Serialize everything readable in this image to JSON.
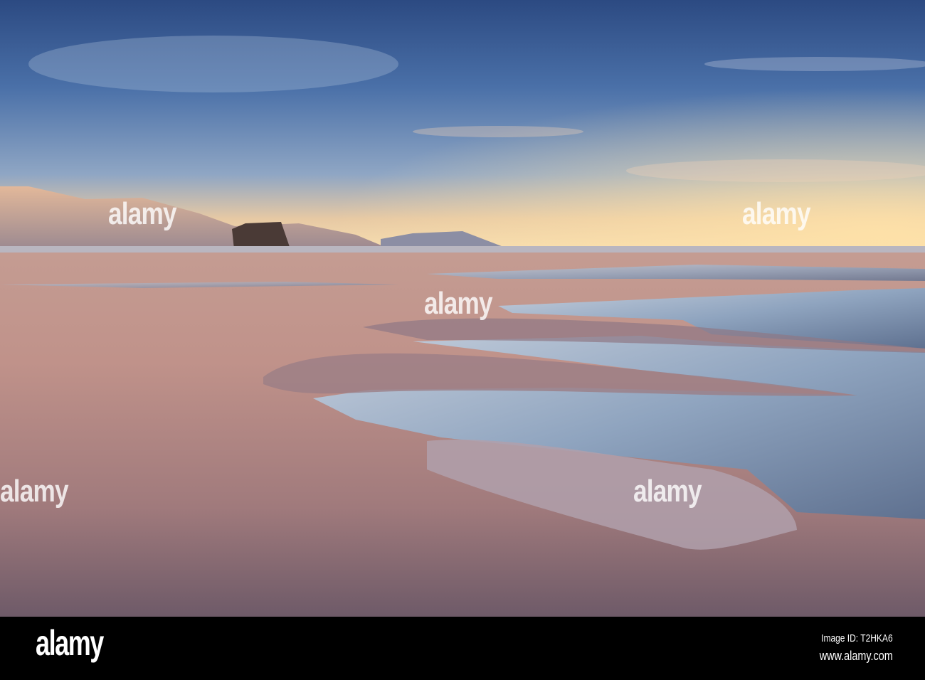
{
  "watermark": {
    "text": "alamy"
  },
  "footer": {
    "logo": "alamy",
    "image_id": "Image ID: T2HKA6",
    "website": "www.alamy.com"
  },
  "colors": {
    "sky_top": "#2f4f86",
    "horizon": "#f4d9a8",
    "sand": "#b98a85",
    "water": "#9fb4cc"
  }
}
